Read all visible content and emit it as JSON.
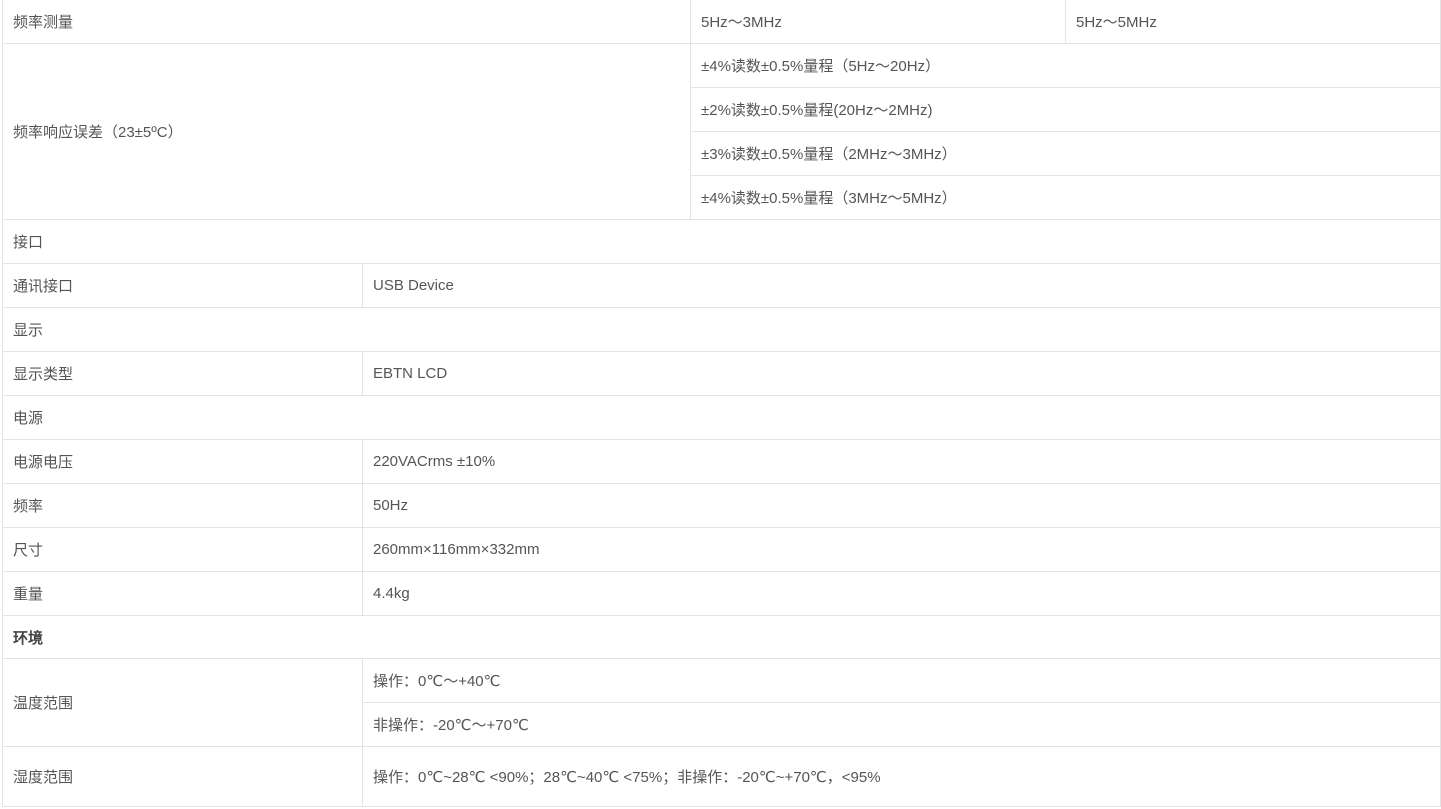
{
  "rows": {
    "freq_measure": {
      "label": "频率测量",
      "value_a": "5Hz～3MHz",
      "value_b": "5Hz～5MHz"
    },
    "freq_response": {
      "label": "频率响应误差（23±5ºC）",
      "values": [
        "±4%读数±0.5%量程（5Hz～20Hz）",
        "±2%读数±0.5%量程(20Hz～2MHz)",
        "±3%读数±0.5%量程（2MHz～3MHz）",
        "±4%读数±0.5%量程（3MHz～5MHz）"
      ]
    },
    "interface_section": {
      "label": "接口"
    },
    "comm_interface": {
      "label": "通讯接口",
      "value": "USB Device"
    },
    "display_section": {
      "label": "显示"
    },
    "display_type": {
      "label": "显示类型",
      "value": "EBTN LCD"
    },
    "power_section": {
      "label": "电源"
    },
    "power_voltage": {
      "label": "电源电压",
      "value": "220VACrms ±10%"
    },
    "frequency": {
      "label": "频率",
      "value": "50Hz"
    },
    "size": {
      "label": "尺寸",
      "value": "260mm×116mm×332mm"
    },
    "weight": {
      "label": "重量",
      "value": "4.4kg"
    },
    "environment_section": {
      "label": "环境"
    },
    "temperature_range": {
      "label": "温度范围",
      "values": [
        "操作：0℃～+40℃",
        "非操作：-20℃～+70℃"
      ]
    },
    "humidity_range": {
      "label": "湿度范围",
      "value": "操作：0℃~28℃ <90%；28℃~40℃ <75%；非操作：-20℃~+70℃，<95%"
    }
  }
}
